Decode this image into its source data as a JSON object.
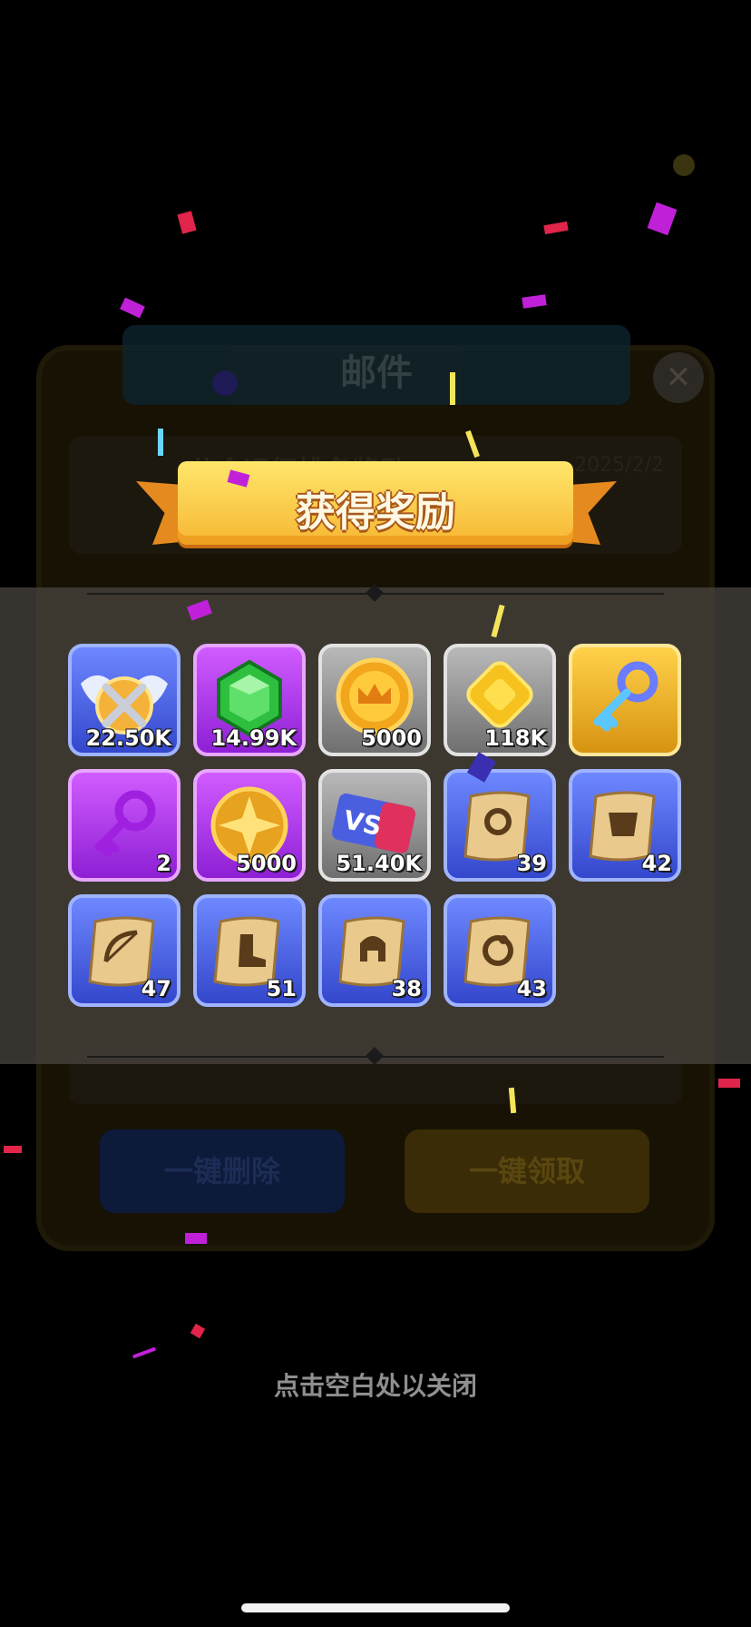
{
  "background": {
    "mail_title": "邮件",
    "close_symbol": "✕",
    "mail_row_title": "公会远征排名奖励",
    "mail_row_date": "2025/2/2",
    "delete_all_label": "一键删除",
    "claim_all_label": "一键领取"
  },
  "reward_popup": {
    "title": "获得奖励",
    "items": [
      {
        "icon": "winged-crossed-swords-badge-icon",
        "rarity": "blue",
        "count": "22.50K"
      },
      {
        "icon": "green-gem-icon",
        "rarity": "purple",
        "count": "14.99K"
      },
      {
        "icon": "crown-coin-icon",
        "rarity": "gray",
        "count": "5000"
      },
      {
        "icon": "gold-diamond-token-icon",
        "rarity": "gray",
        "count": "118K"
      },
      {
        "icon": "gold-key-icon",
        "rarity": "gold",
        "count": ""
      },
      {
        "icon": "purple-key-icon",
        "rarity": "purple",
        "count": "2"
      },
      {
        "icon": "star-medal-icon",
        "rarity": "purple",
        "count": "5000"
      },
      {
        "icon": "vs-ticket-icon",
        "rarity": "gray",
        "count": "51.40K"
      },
      {
        "icon": "scroll-necklace-icon",
        "rarity": "blue",
        "count": "39"
      },
      {
        "icon": "scroll-armor-icon",
        "rarity": "blue",
        "count": "42"
      },
      {
        "icon": "scroll-bow-icon",
        "rarity": "blue",
        "count": "47"
      },
      {
        "icon": "scroll-boot-icon",
        "rarity": "blue",
        "count": "51"
      },
      {
        "icon": "scroll-helmet-icon",
        "rarity": "blue",
        "count": "38"
      },
      {
        "icon": "scroll-ring-icon",
        "rarity": "blue",
        "count": "43"
      }
    ]
  },
  "close_hint": "点击空白处以关闭",
  "colors": {
    "ribbon": "#f7b733",
    "tile_blue": "#3347cc",
    "tile_purple": "#8d1fd4",
    "tile_gray": "#6f6f6f",
    "tile_gold": "#d79312"
  }
}
